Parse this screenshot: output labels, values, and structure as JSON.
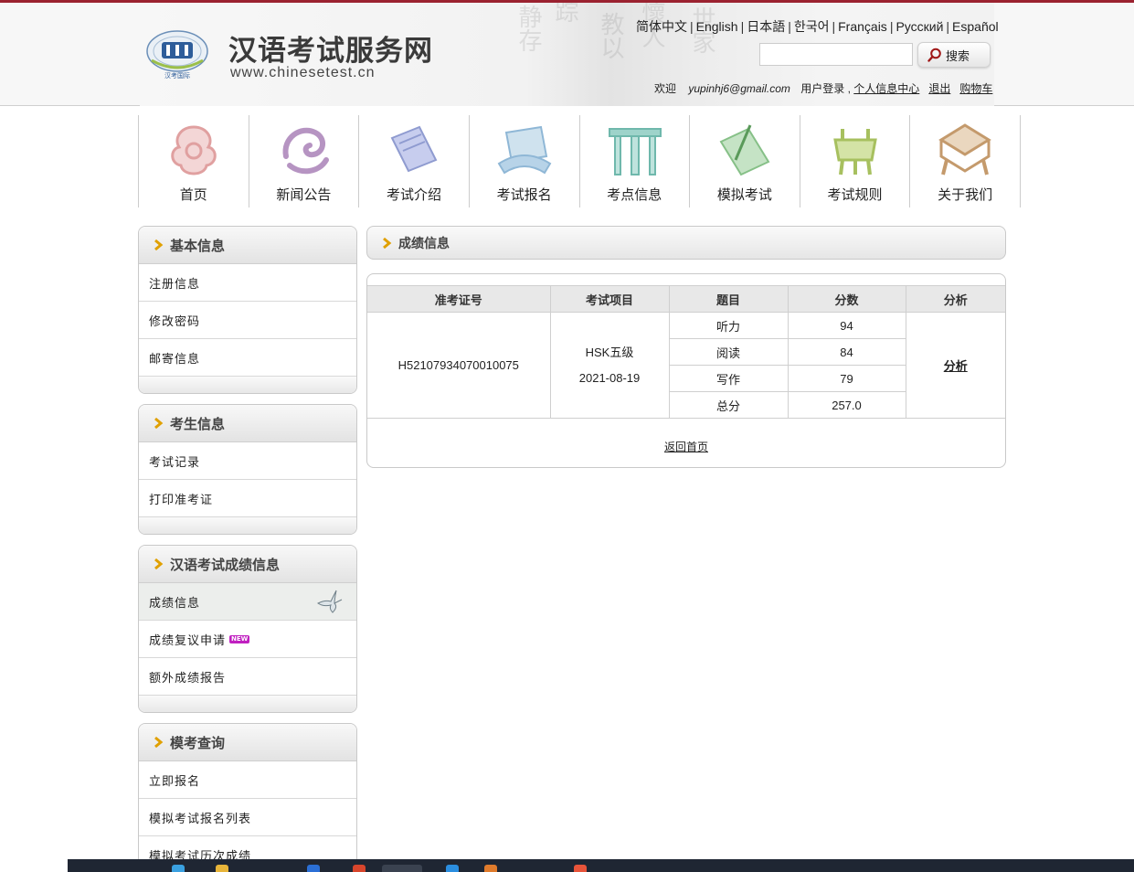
{
  "header": {
    "site_title": "汉语考试服务网",
    "site_url": "www.chinesetest.cn",
    "emblem_text": "汉考国际",
    "languages": [
      "简体中文",
      "English",
      "日本語",
      "한국어",
      "Français",
      "Русский",
      "Español"
    ],
    "search": {
      "placeholder": "",
      "button_label": "搜索"
    },
    "user": {
      "welcome": "欢迎",
      "email": "yupinhj6@gmail.com",
      "login_text": "用户登录 ,",
      "profile_link": "个人信息中心",
      "logout_link": "退出",
      "cart_link": "购物车"
    }
  },
  "nav": {
    "items": [
      {
        "label": "首页",
        "icon": "cloud-knot-icon",
        "color": "#e6a9a9"
      },
      {
        "label": "新闻公告",
        "icon": "swirl-cloud-icon",
        "color": "#b694c2"
      },
      {
        "label": "考试介绍",
        "icon": "scroll-icon",
        "color": "#9aa6d8"
      },
      {
        "label": "考试报名",
        "icon": "scroll-fan-icon",
        "color": "#9ec0d9"
      },
      {
        "label": "考点信息",
        "icon": "archway-icon",
        "color": "#8fcbc2"
      },
      {
        "label": "模拟考试",
        "icon": "writing-scroll-icon",
        "color": "#99c79a"
      },
      {
        "label": "考试规则",
        "icon": "ding-vessel-icon",
        "color": "#b5cc7a"
      },
      {
        "label": "关于我们",
        "icon": "box-icon",
        "color": "#c8a37e"
      }
    ]
  },
  "sidebar": {
    "panels": [
      {
        "title": "基本信息",
        "items": [
          "注册信息",
          "修改密码",
          "邮寄信息"
        ]
      },
      {
        "title": "考生信息",
        "items": [
          "考试记录",
          "打印准考证"
        ]
      },
      {
        "title": "汉语考试成绩信息",
        "items": [
          "成绩信息",
          "成绩复议申请",
          "额外成绩报告"
        ],
        "active_item": "成绩信息",
        "new_badge": "NEW"
      },
      {
        "title": "模考查询",
        "items": [
          "立即报名",
          "模拟考试报名列表",
          "模拟考试历次成绩"
        ]
      }
    ]
  },
  "content": {
    "title": "成绩信息",
    "table": {
      "headers": [
        "准考证号",
        "考试项目",
        "题目",
        "分数",
        "分析"
      ],
      "ticket_no": "H52107934070010075",
      "exam_name": "HSK五级",
      "exam_date": "2021-08-19",
      "rows": [
        {
          "subject": "听力",
          "score": "94"
        },
        {
          "subject": "阅读",
          "score": "84"
        },
        {
          "subject": "写作",
          "score": "79"
        },
        {
          "subject": "总分",
          "score": "257.0"
        }
      ],
      "analysis_link": "分析"
    },
    "back_link": "返回首页"
  },
  "colors": {
    "top_line": "#9b2230",
    "chevron": "#e0a000",
    "new_badge": "#c020c0"
  }
}
